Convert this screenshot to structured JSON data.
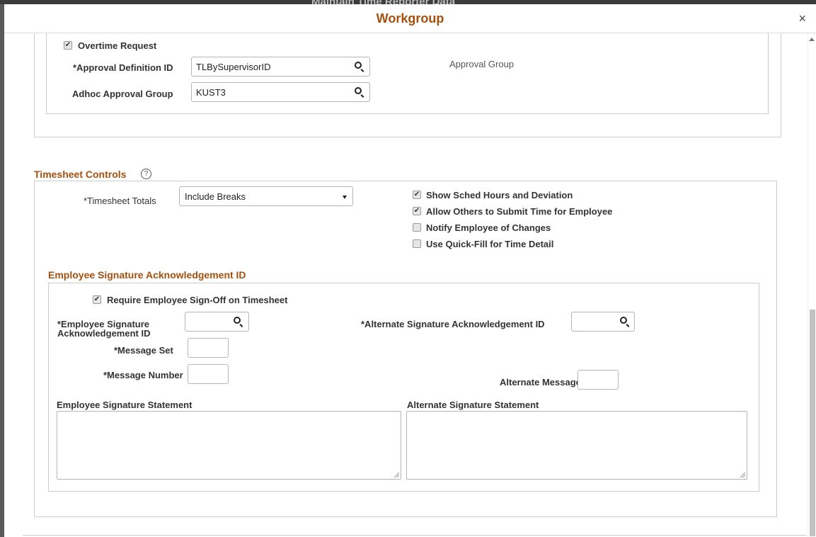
{
  "modal": {
    "title": "Workgroup",
    "background_title": "Maintain Time Reporter Data",
    "close": "×"
  },
  "approval": {
    "overtime_request": {
      "label": "Overtime Request",
      "checked": true
    },
    "approval_definition_label": "*Approval Definition ID",
    "approval_definition_value": "TLBySupervisorID",
    "approval_group_label": "Approval Group",
    "adhoc_label": "Adhoc Approval Group",
    "adhoc_value": "KUST3"
  },
  "timesheet": {
    "section_title": "Timesheet Controls",
    "help": "?",
    "totals_label": "*Timesheet Totals",
    "totals_value": "Include Breaks",
    "checkboxes": [
      {
        "label": "Show Sched Hours and Deviation",
        "checked": true
      },
      {
        "label": "Allow Others to Submit Time for Employee",
        "checked": true
      },
      {
        "label": "Notify Employee of Changes",
        "checked": false
      },
      {
        "label": "Use Quick-Fill for Time Detail",
        "checked": false
      }
    ]
  },
  "signature": {
    "section_title": "Employee Signature Acknowledgement ID",
    "require_label": "Require Employee Sign-Off on Timesheet",
    "require_checked": true,
    "emp_sig_label_line1": "*Employee Signature",
    "emp_sig_label_line2": "Acknowledgement ID",
    "emp_sig_value": "",
    "alt_sig_label": "*Alternate Signature Acknowledgement ID",
    "alt_sig_value": "",
    "message_set_label": "*Message Set",
    "message_set_value": "",
    "message_number_label": "*Message Number",
    "message_number_value": "",
    "alt_message_label": "Alternate Message",
    "alt_message_value": "",
    "emp_statement_label": "Employee Signature Statement",
    "alt_statement_label": "Alternate Signature Statement"
  },
  "icons": {
    "search": "search-icon",
    "close": "close-icon",
    "help": "help-icon",
    "checkbox": "checkbox-icon"
  }
}
